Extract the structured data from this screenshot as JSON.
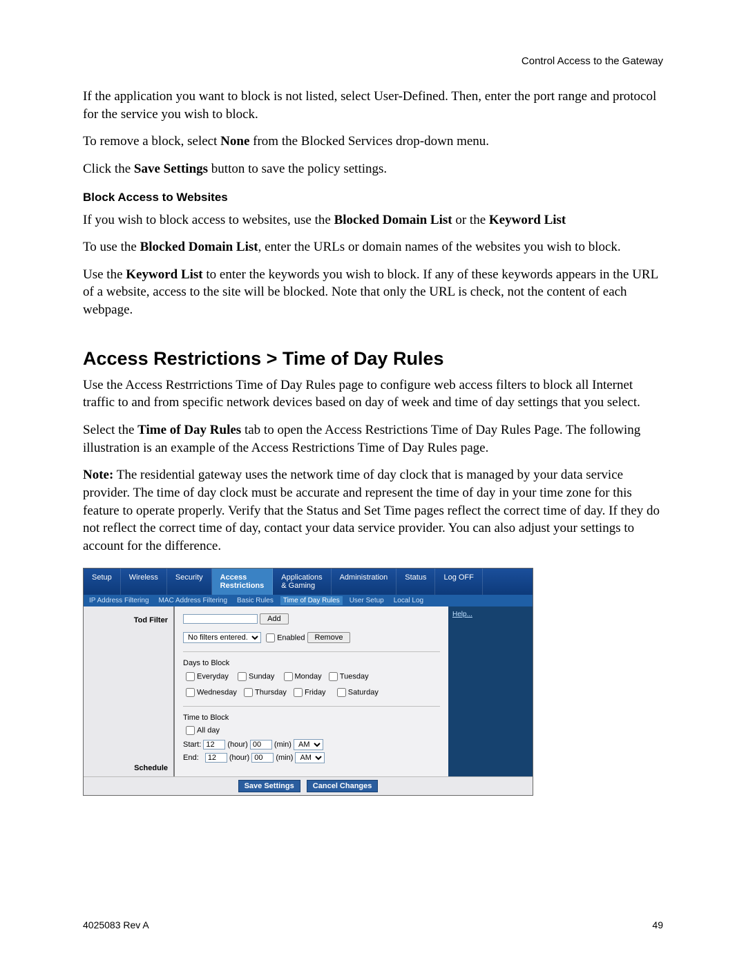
{
  "header": {
    "section": "Control Access to the Gateway"
  },
  "paragraphs": {
    "p1": "If the application you want to block is not listed, select User-Defined. Then, enter the port range and protocol for the service you wish to block.",
    "p2a": "To remove a block, select ",
    "p2b": "None",
    "p2c": " from the Blocked Services drop-down menu.",
    "p3a": "Click the ",
    "p3b": "Save Settings",
    "p3c": " button to save the policy settings.",
    "sub1": "Block Access to Websites",
    "p4a": "If you wish to block access to websites, use the ",
    "p4b": "Blocked Domain List",
    "p4c": " or the ",
    "p4d": "Keyword List",
    "p5a": "To use the ",
    "p5b": "Blocked Domain List",
    "p5c": ", enter the URLs or domain names of the websites you wish to block.",
    "p6a": "Use the ",
    "p6b": "Keyword List",
    "p6c": " to enter the keywords you wish to block. If any of these keywords appears in the URL of a website, access to the site will be blocked. Note that only the URL is check, not the content of each webpage.",
    "h2": "Access Restrictions > Time of Day Rules",
    "p7": "Use the Access Restrrictions Time of Day Rules page to configure web access filters to block all Internet traffic to and from specific network devices based on day of week and time of day settings that you select.",
    "p8a": "Select the ",
    "p8b": "Time of Day Rules",
    "p8c": " tab to open the Access Restrictions Time of Day Rules Page. The following illustration is an example of the Access Restrictions Time of Day Rules page.",
    "p9a": "Note:",
    "p9b": "  The residential gateway uses the network time of day clock that is managed by your data service provider. The time of day clock must be accurate and represent the time of day in your time zone for this feature to operate properly. Verify that the Status and Set Time pages reflect the correct time of day. If they do not reflect the correct time of day, contact your data service provider. You can also adjust your settings to account for the difference."
  },
  "ui": {
    "tabs": [
      "Setup",
      "Wireless",
      "Security",
      "Access\nRestrictions",
      "Applications\n& Gaming",
      "Administration",
      "Status",
      "Log OFF"
    ],
    "subtabs": [
      "IP Address Filtering",
      "MAC Address Filtering",
      "Basic Rules",
      "Time of Day Rules",
      "User Setup",
      "Local Log"
    ],
    "leftLabels": {
      "tod": "Tod Filter",
      "schedule": "Schedule"
    },
    "help": "Help...",
    "addBtn": "Add",
    "filterSelect": "No filters entered.",
    "enabled": "Enabled",
    "removeBtn": "Remove",
    "daysLabel": "Days to Block",
    "days": [
      "Everyday",
      "Sunday",
      "Monday",
      "Tuesday",
      "Wednesday",
      "Thursday",
      "Friday",
      "Saturday"
    ],
    "timeLabel": "Time to Block",
    "allDay": "All day",
    "start": "Start:",
    "end": "End:",
    "hour": "(hour)",
    "min": "(min)",
    "am": "AM",
    "hourVal": "12",
    "minVal": "00",
    "save": "Save Settings",
    "cancel": "Cancel Changes"
  },
  "footer": {
    "left": "4025083 Rev A",
    "right": "49"
  }
}
